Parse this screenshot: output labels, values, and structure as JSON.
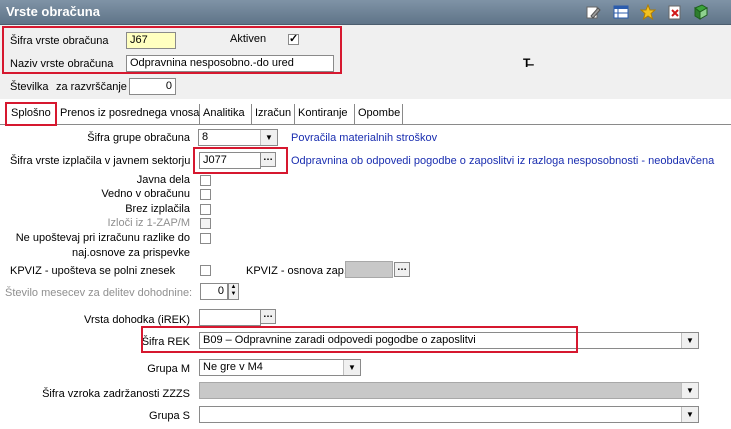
{
  "window": {
    "title": "Vrste obračuna"
  },
  "toolbar_icons": [
    "edit-icon",
    "table-icon",
    "star-icon",
    "delete-icon",
    "book-icon"
  ],
  "header": {
    "sifra_label": "Šifra vrste obračuna",
    "sifra_value": "J67",
    "aktiven_label": "Aktiven",
    "naziv_label": "Naziv vrste obračuna",
    "naziv_value": "Odpravnina nesposobno.-do ured",
    "stevilka_label": "Številka",
    "razvrscanje_label": "za razvrščanje",
    "razvrscanje_value": "0"
  },
  "tabs": [
    "Splošno",
    "Prenos iz posrednega vnosa",
    "Analitika",
    "Izračun",
    "Kontiranje",
    "Opombe"
  ],
  "form": {
    "grupa_label": "Šifra grupe obračuna",
    "grupa_value": "8",
    "grupa_desc": "Povračila materialnih stroškov",
    "izplacila_label": "Šifra vrste izplačila v javnem sektorju",
    "izplacila_value": "J077",
    "izplacila_desc": "Odpravnina ob odpovedi pogodbe o zaposlitvi iz razloga nesposobnosti - neobdavčena",
    "javna_dela_label": "Javna dela",
    "vedno_label": "Vedno v obračunu",
    "brez_label": "Brez izplačila",
    "izloci_label": "Izloči iz 1-ZAP/M",
    "neupostevaj_label_1": "Ne upoštevaj pri izračunu razlike do",
    "neupostevaj_label_2": "naj.osnove za prispevke",
    "kpviz_polni_label": "KPVIZ - upošteva se polni znesek",
    "kpviz_osnova_label": "KPVIZ - osnova zap.",
    "stevilo_mesecev_label": "Število mesecev za delitev dohodnine:",
    "stevilo_mesecev_value": "0",
    "vrsta_dohodka_label": "Vrsta dohodka (iREK)",
    "sifra_rek_label": "Šifra REK",
    "sifra_rek_value": "B09 – Odpravnine zaradi odpovedi pogodbe o zaposlitvi",
    "grupa_m_label": "Grupa M",
    "grupa_m_value": "Ne gre v M4",
    "zzzs_label": "Šifra vzroka zadržanosti ZZZS",
    "grupa_s_label": "Grupa S"
  },
  "colors": {
    "highlight": "#d6182f",
    "link": "#1a2eb0",
    "titlebar": "#6b8096"
  }
}
